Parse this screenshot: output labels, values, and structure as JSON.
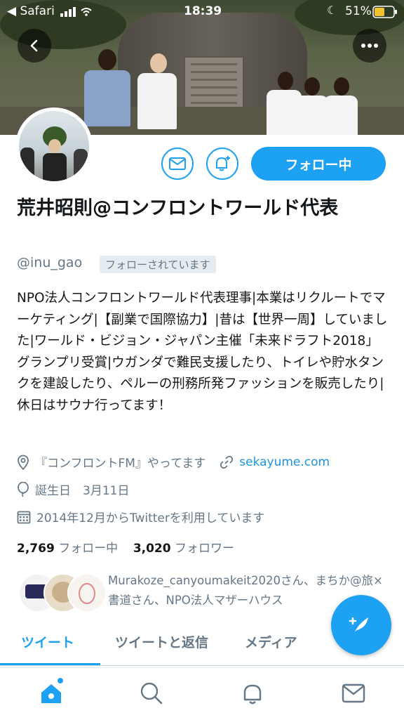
{
  "status_bar": {
    "carrier": "◀ Safari",
    "time": "18:39",
    "battery": "51%"
  },
  "profile": {
    "display_name": "荒井昭則@コンフロントワールド代表",
    "handle": "@inu_gao",
    "follows_you": "フォローされています",
    "bio": "NPO法人コンフロントワールド代表理事|本業はリクルートでマーケティング|【副業で国際協力】|昔は【世界一周】していました|ワールド・ビジョン・ジャパン主催「未来ドラフト2018」グランプリ受賞|ウガンダで難民支援したり、トイレや貯水タンクを建設したり、ペルーの刑務所発ファッションを販売したり|休日はサウナ行ってます！",
    "location": "『コンフロントFM』やってます",
    "website": "sekayume.com",
    "birthday": "誕生日　3月11日",
    "joined": "2014年12月からTwitterを利用しています",
    "following_count": "2,769",
    "following_label": "フォロー中",
    "followers_count": "3,020",
    "followers_label": "フォロワー",
    "mutual_text": "Murakoze_canyoumakeit2020さん、まちか@旅×書道さん、NPO法人マザーハウス"
  },
  "actions": {
    "follow_button": "フォロー中"
  },
  "tabs": [
    "ツイート",
    "ツイートと返信",
    "メディア"
  ],
  "colors": {
    "accent": "#1da1f2",
    "text": "#14171a",
    "muted": "#657786"
  },
  "icons": [
    "back-icon",
    "more-icon",
    "mail-icon",
    "bell-plus-icon",
    "location-icon",
    "link-icon",
    "balloon-icon",
    "calendar-icon",
    "compose-icon",
    "home-icon",
    "search-icon",
    "notifications-icon",
    "messages-icon"
  ]
}
